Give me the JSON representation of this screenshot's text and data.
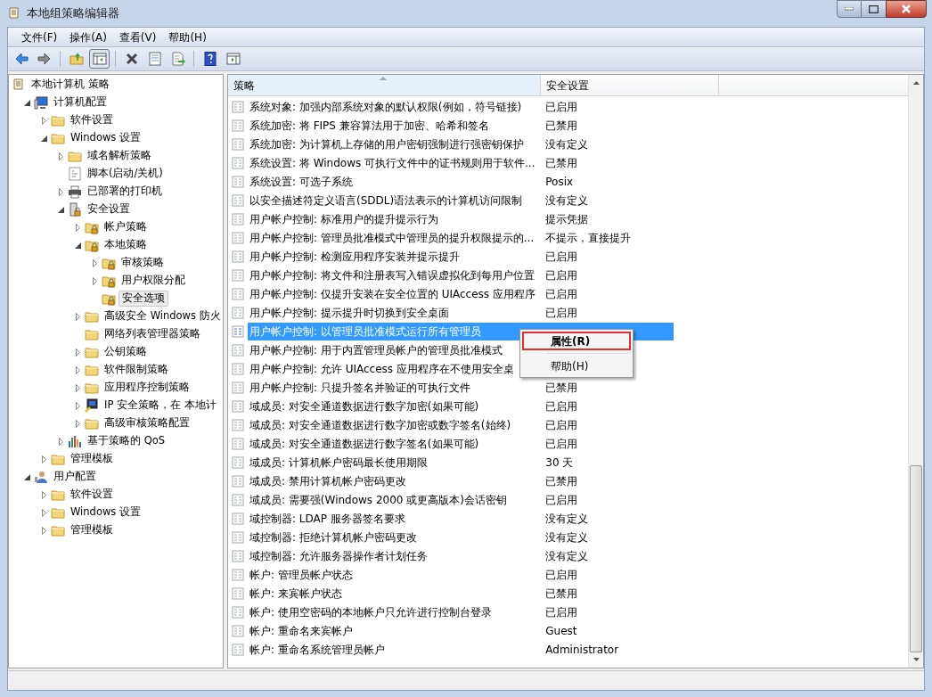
{
  "window": {
    "title": "本地组策略编辑器"
  },
  "menu_bar": [
    "文件(F)",
    "操作(A)",
    "查看(V)",
    "帮助(H)"
  ],
  "toolbar": [
    {
      "kind": "back"
    },
    {
      "kind": "forward"
    },
    {
      "kind": "sep"
    },
    {
      "kind": "up"
    },
    {
      "kind": "tree",
      "selected": true
    },
    {
      "kind": "sep"
    },
    {
      "kind": "delete"
    },
    {
      "kind": "properties"
    },
    {
      "kind": "export"
    },
    {
      "kind": "sep"
    },
    {
      "kind": "help"
    },
    {
      "kind": "action"
    }
  ],
  "tree": [
    {
      "label": "本地计算机 策略",
      "selected": false,
      "children": [
        {
          "label": "计算机配置",
          "expanded": true,
          "selected": false,
          "children": [
            {
              "label": "软件设置",
              "expanded": false,
              "selected": false
            },
            {
              "label": "Windows 设置",
              "expanded": true,
              "selected": false,
              "children": [
                {
                  "label": "域名解析策略",
                  "expanded": false,
                  "selected": false
                },
                {
                  "label": "脚本(启动/关机)",
                  "selected": false
                },
                {
                  "label": "已部署的打印机",
                  "expanded": false,
                  "selected": false
                },
                {
                  "label": "安全设置",
                  "expanded": true,
                  "selected": false,
                  "children": [
                    {
                      "label": "帐户策略",
                      "expanded": false,
                      "selected": false
                    },
                    {
                      "label": "本地策略",
                      "expanded": true,
                      "selected": false,
                      "children": [
                        {
                          "label": "审核策略",
                          "expanded": false,
                          "selected": false
                        },
                        {
                          "label": "用户权限分配",
                          "expanded": false,
                          "selected": false
                        },
                        {
                          "label": "安全选项",
                          "selected": true
                        }
                      ]
                    },
                    {
                      "label": "高级安全 Windows 防火",
                      "expanded": false,
                      "selected": false
                    },
                    {
                      "label": "网络列表管理器策略",
                      "selected": false
                    },
                    {
                      "label": "公钥策略",
                      "expanded": false,
                      "selected": false
                    },
                    {
                      "label": "软件限制策略",
                      "expanded": false,
                      "selected": false
                    },
                    {
                      "label": "应用程序控制策略",
                      "expanded": false,
                      "selected": false
                    },
                    {
                      "label": "IP 安全策略，在 本地计",
                      "expanded": false,
                      "selected": false
                    },
                    {
                      "label": "高级审核策略配置",
                      "expanded": false,
                      "selected": false
                    }
                  ]
                },
                {
                  "label": "基于策略的 QoS",
                  "expanded": false,
                  "selected": false
                }
              ]
            },
            {
              "label": "管理模板",
              "expanded": false,
              "selected": false
            }
          ]
        },
        {
          "label": "用户配置",
          "expanded": true,
          "selected": false,
          "children": [
            {
              "label": "软件设置",
              "expanded": false,
              "selected": false
            },
            {
              "label": "Windows 设置",
              "expanded": false,
              "selected": false
            },
            {
              "label": "管理模板",
              "expanded": false,
              "selected": false
            }
          ]
        }
      ]
    }
  ],
  "table": {
    "columns": [
      "策略",
      "安全设置"
    ],
    "rows": [
      {
        "policy": "系统对象: 加强内部系统对象的默认权限(例如，符号链接)",
        "setting": "已启用",
        "selected": false
      },
      {
        "policy": "系统加密: 将 FIPS 兼容算法用于加密、哈希和签名",
        "setting": "已禁用",
        "selected": false
      },
      {
        "policy": "系统加密: 为计算机上存储的用户密钥强制进行强密钥保护",
        "setting": "没有定义",
        "selected": false
      },
      {
        "policy": "系统设置: 将 Windows 可执行文件中的证书规则用于软件...",
        "setting": "已禁用",
        "selected": false
      },
      {
        "policy": "系统设置: 可选子系统",
        "setting": "Posix",
        "selected": false
      },
      {
        "policy": "以安全描述符定义语言(SDDL)语法表示的计算机访问限制",
        "setting": "没有定义",
        "selected": false
      },
      {
        "policy": "用户帐户控制: 标准用户的提升提示行为",
        "setting": "提示凭据",
        "selected": false
      },
      {
        "policy": "用户帐户控制: 管理员批准模式中管理员的提升权限提示的...",
        "setting": "不提示，直接提升",
        "selected": false
      },
      {
        "policy": "用户帐户控制: 检测应用程序安装并提示提升",
        "setting": "已启用",
        "selected": false
      },
      {
        "policy": "用户帐户控制: 将文件和注册表写入错误虚拟化到每用户位置",
        "setting": "已启用",
        "selected": false
      },
      {
        "policy": "用户帐户控制: 仅提升安装在安全位置的 UIAccess 应用程序",
        "setting": "已启用",
        "selected": false
      },
      {
        "policy": "用户帐户控制: 提示提升时切换到安全桌面",
        "setting": "已启用",
        "selected": false
      },
      {
        "policy": "用户帐户控制: 以管理员批准模式运行所有管理员",
        "selected": true
      },
      {
        "policy": "用户帐户控制: 用于内置管理员帐户的管理员批准模式",
        "selected": false
      },
      {
        "policy": "用户帐户控制: 允许 UIAccess 应用程序在不使用安全桌",
        "selected": false
      },
      {
        "policy": "用户帐户控制: 只提升签名并验证的可执行文件",
        "setting": "已禁用",
        "selected": false
      },
      {
        "policy": "域成员: 对安全通道数据进行数字加密(如果可能)",
        "setting": "已启用",
        "selected": false
      },
      {
        "policy": "域成员: 对安全通道数据进行数字加密或数字签名(始终)",
        "setting": "已启用",
        "selected": false
      },
      {
        "policy": "域成员: 对安全通道数据进行数字签名(如果可能)",
        "setting": "已启用",
        "selected": false
      },
      {
        "policy": "域成员: 计算机帐户密码最长使用期限",
        "setting": "30 天",
        "selected": false
      },
      {
        "policy": "域成员: 禁用计算机帐户密码更改",
        "setting": "已禁用",
        "selected": false
      },
      {
        "policy": "域成员: 需要强(Windows 2000 或更高版本)会话密钥",
        "setting": "已启用",
        "selected": false
      },
      {
        "policy": "域控制器: LDAP 服务器签名要求",
        "setting": "没有定义",
        "selected": false
      },
      {
        "policy": "域控制器: 拒绝计算机帐户密码更改",
        "setting": "没有定义",
        "selected": false
      },
      {
        "policy": "域控制器: 允许服务器操作者计划任务",
        "setting": "没有定义",
        "selected": false
      },
      {
        "policy": "帐户: 管理员帐户状态",
        "setting": "已启用",
        "selected": false
      },
      {
        "policy": "帐户: 来宾帐户状态",
        "setting": "已禁用",
        "selected": false
      },
      {
        "policy": "帐户: 使用空密码的本地帐户只允许进行控制台登录",
        "setting": "已启用",
        "selected": false
      },
      {
        "policy": "帐户: 重命名来宾帐户",
        "setting": "Guest",
        "selected": false
      },
      {
        "policy": "帐户: 重命名系统管理员帐户",
        "setting": "Administrator",
        "selected": false
      }
    ]
  },
  "context_menu": [
    {
      "label": "属性(R)",
      "default": true,
      "selected": true
    },
    {
      "label": "帮助(H)",
      "default": false,
      "selected": false
    }
  ]
}
